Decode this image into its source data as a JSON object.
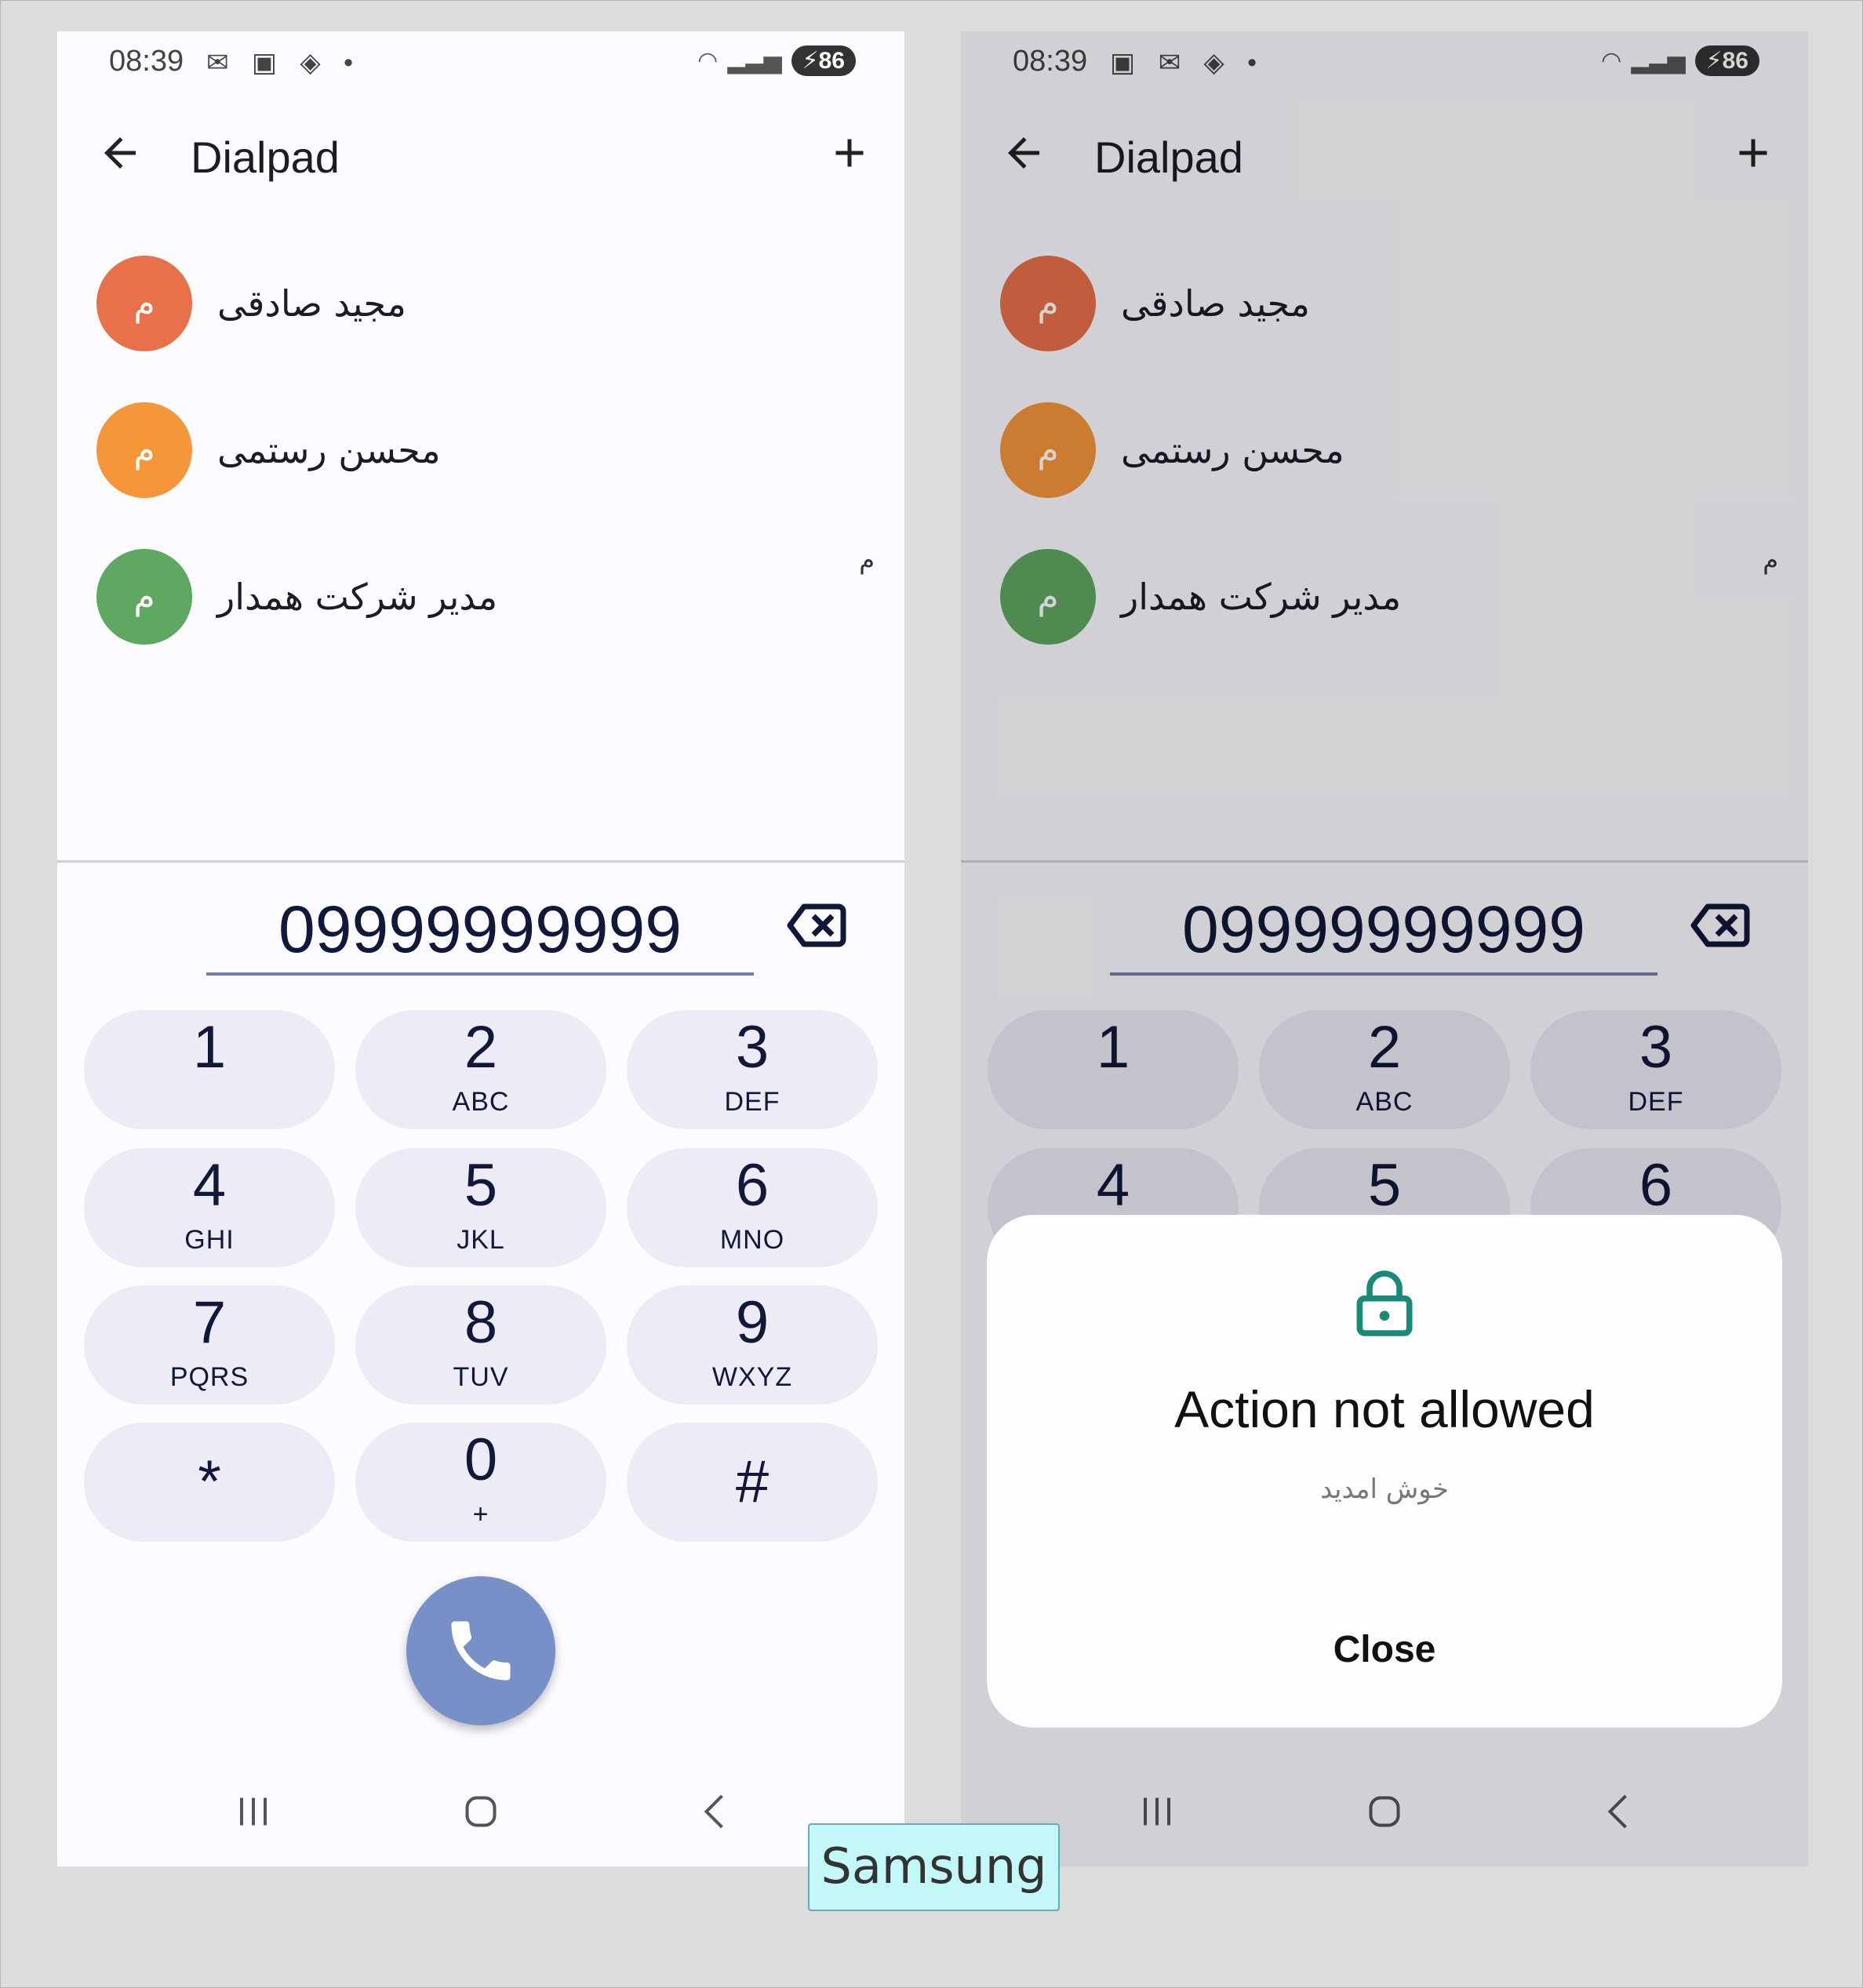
{
  "screens": [
    {
      "status": {
        "time": "08:39",
        "battery": "86"
      },
      "appbar": {
        "title": "Dialpad"
      },
      "contacts": [
        {
          "initial": "م",
          "name": "مجید صادقی",
          "color": "#e8704a"
        },
        {
          "initial": "م",
          "name": "محسن رستمی",
          "color": "#f5963a"
        },
        {
          "initial": "م",
          "name": "مدیر شرکت همدار",
          "color": "#5fa862"
        }
      ],
      "index_letter": "م",
      "number": "09999999999",
      "keys": [
        {
          "digit": "1",
          "letters": ""
        },
        {
          "digit": "2",
          "letters": "ABC"
        },
        {
          "digit": "3",
          "letters": "DEF"
        },
        {
          "digit": "4",
          "letters": "GHI"
        },
        {
          "digit": "5",
          "letters": "JKL"
        },
        {
          "digit": "6",
          "letters": "MNO"
        },
        {
          "digit": "7",
          "letters": "PQRS"
        },
        {
          "digit": "8",
          "letters": "TUV"
        },
        {
          "digit": "9",
          "letters": "WXYZ"
        },
        {
          "digit": "*",
          "letters": ""
        },
        {
          "digit": "0",
          "letters": "+"
        },
        {
          "digit": "#",
          "letters": ""
        }
      ]
    },
    {
      "status": {
        "time": "08:39",
        "battery": "86"
      },
      "appbar": {
        "title": "Dialpad"
      },
      "contacts": [
        {
          "initial": "م",
          "name": "مجید صادقی",
          "color": "#c65a3e"
        },
        {
          "initial": "م",
          "name": "محسن رستمی",
          "color": "#d07c30"
        },
        {
          "initial": "م",
          "name": "مدیر شرکت همدار",
          "color": "#518c55"
        }
      ],
      "index_letter": "م",
      "number": "09999999999",
      "keys": [
        {
          "digit": "1",
          "letters": ""
        },
        {
          "digit": "2",
          "letters": "ABC"
        },
        {
          "digit": "3",
          "letters": "DEF"
        },
        {
          "digit": "4",
          "letters": ""
        },
        {
          "digit": "5",
          "letters": ""
        },
        {
          "digit": "6",
          "letters": ""
        }
      ],
      "dialog": {
        "title": "Action not allowed",
        "message": "خوش امدید",
        "close_label": "Close"
      }
    }
  ],
  "caption": "Samsung",
  "colors": {
    "accent": "#7890c8",
    "dialog_icon": "#1a8a78",
    "key_bg": "#ecebf6"
  }
}
